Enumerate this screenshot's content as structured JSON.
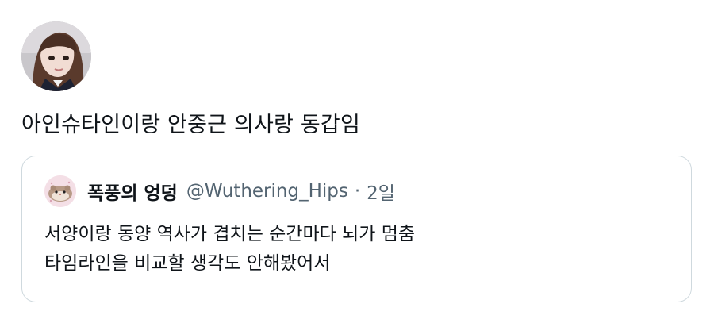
{
  "tweet": {
    "text": "아인슈타인이랑 안중근 의사랑 동갑임"
  },
  "quote": {
    "display_name": "폭풍의 엉덩",
    "handle": "@Wuthering_Hips",
    "separator": "·",
    "time": "2일",
    "lines": [
      "서양이랑 동양 역사가 겹치는 순간마다 뇌가 멈춤",
      "타임라인을 비교할 생각도 안해봤어서"
    ]
  },
  "colors": {
    "text": "#0f1419",
    "secondary": "#536471",
    "border": "#cfd9de"
  },
  "icons": {
    "author_avatar": "profile-photo-avatar",
    "quote_avatar": "hamster-avatar"
  }
}
